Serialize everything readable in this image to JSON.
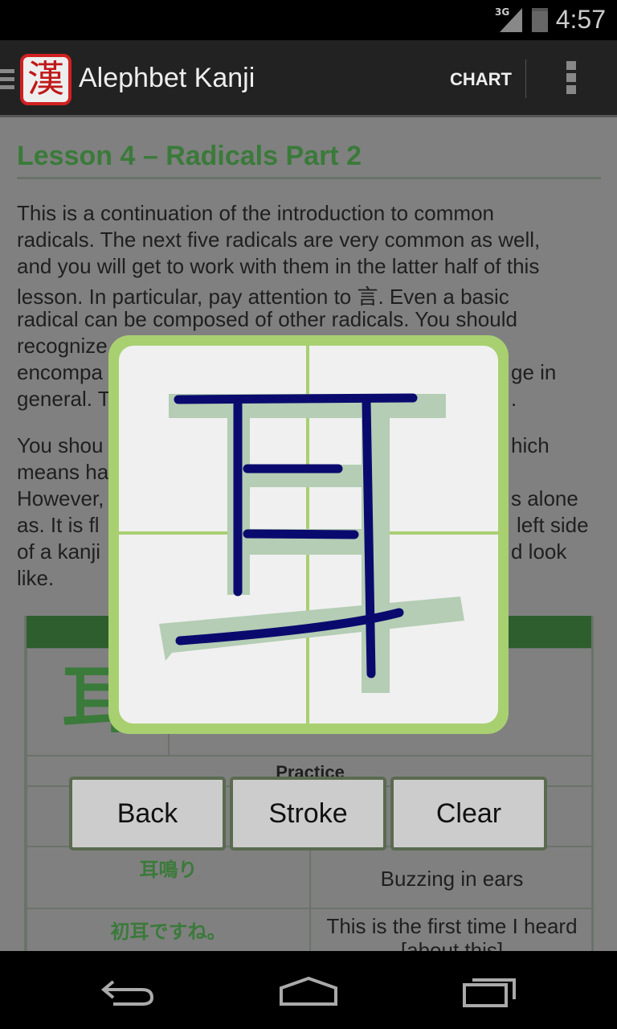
{
  "status": {
    "network": "3G",
    "time": "4:57"
  },
  "appbar": {
    "title": "Alephbet Kanji",
    "logo_char": "漢",
    "chart_label": "CHART"
  },
  "lesson": {
    "title": "Lesson 4 – Radicals Part 2",
    "lines": [
      "This is a continuation of the introduction to common",
      "radicals. The next five radicals are very common as well,",
      "and you will get to work with them in the latter half of this",
      "lesson. In particular, pay attention to 言. Even a basic",
      "radical can be composed of other radicals. You should",
      "recognize",
      "encompa",
      "ge in",
      "general. T",
      "."
    ],
    "lines2": [
      "You shou",
      "hich",
      "means ha",
      "However,",
      "s alone",
      "as. It is fl",
      "left side",
      "of a kanji",
      "d look",
      "like."
    ]
  },
  "table": {
    "kanji": "耳",
    "practice_label": "Practice",
    "rows": [
      {
        "jp": "耳鳴り",
        "en": "Buzzing in ears"
      },
      {
        "jp": "初耳ですね。",
        "en": "This is the first time I heard",
        "en2": "[about this]"
      }
    ]
  },
  "dialog": {
    "buttons": {
      "back": "Back",
      "stroke": "Stroke",
      "clear": "Clear"
    },
    "colors": {
      "frame": "#a8d070",
      "guide": "#b4cdb4",
      "ink": "#0a0a6e"
    }
  }
}
